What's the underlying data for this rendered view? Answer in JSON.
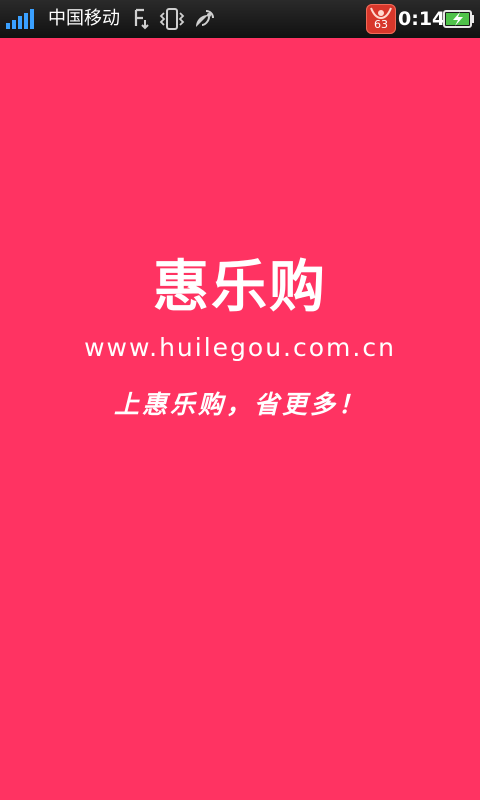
{
  "status_bar": {
    "carrier": "中国移动",
    "notification_badge_count": "63",
    "time": "0:14",
    "icons": [
      "signal-strength-icon",
      "usb-transfer-icon",
      "vibrate-icon",
      "gps-satellite-icon",
      "app-notification-icon",
      "battery-charging-icon"
    ]
  },
  "splash": {
    "title": "惠乐购",
    "url": "www.huilegou.com.cn",
    "slogan": "上惠乐购，省更多！",
    "background_color": "#ff3362",
    "text_color": "#ffffff"
  }
}
